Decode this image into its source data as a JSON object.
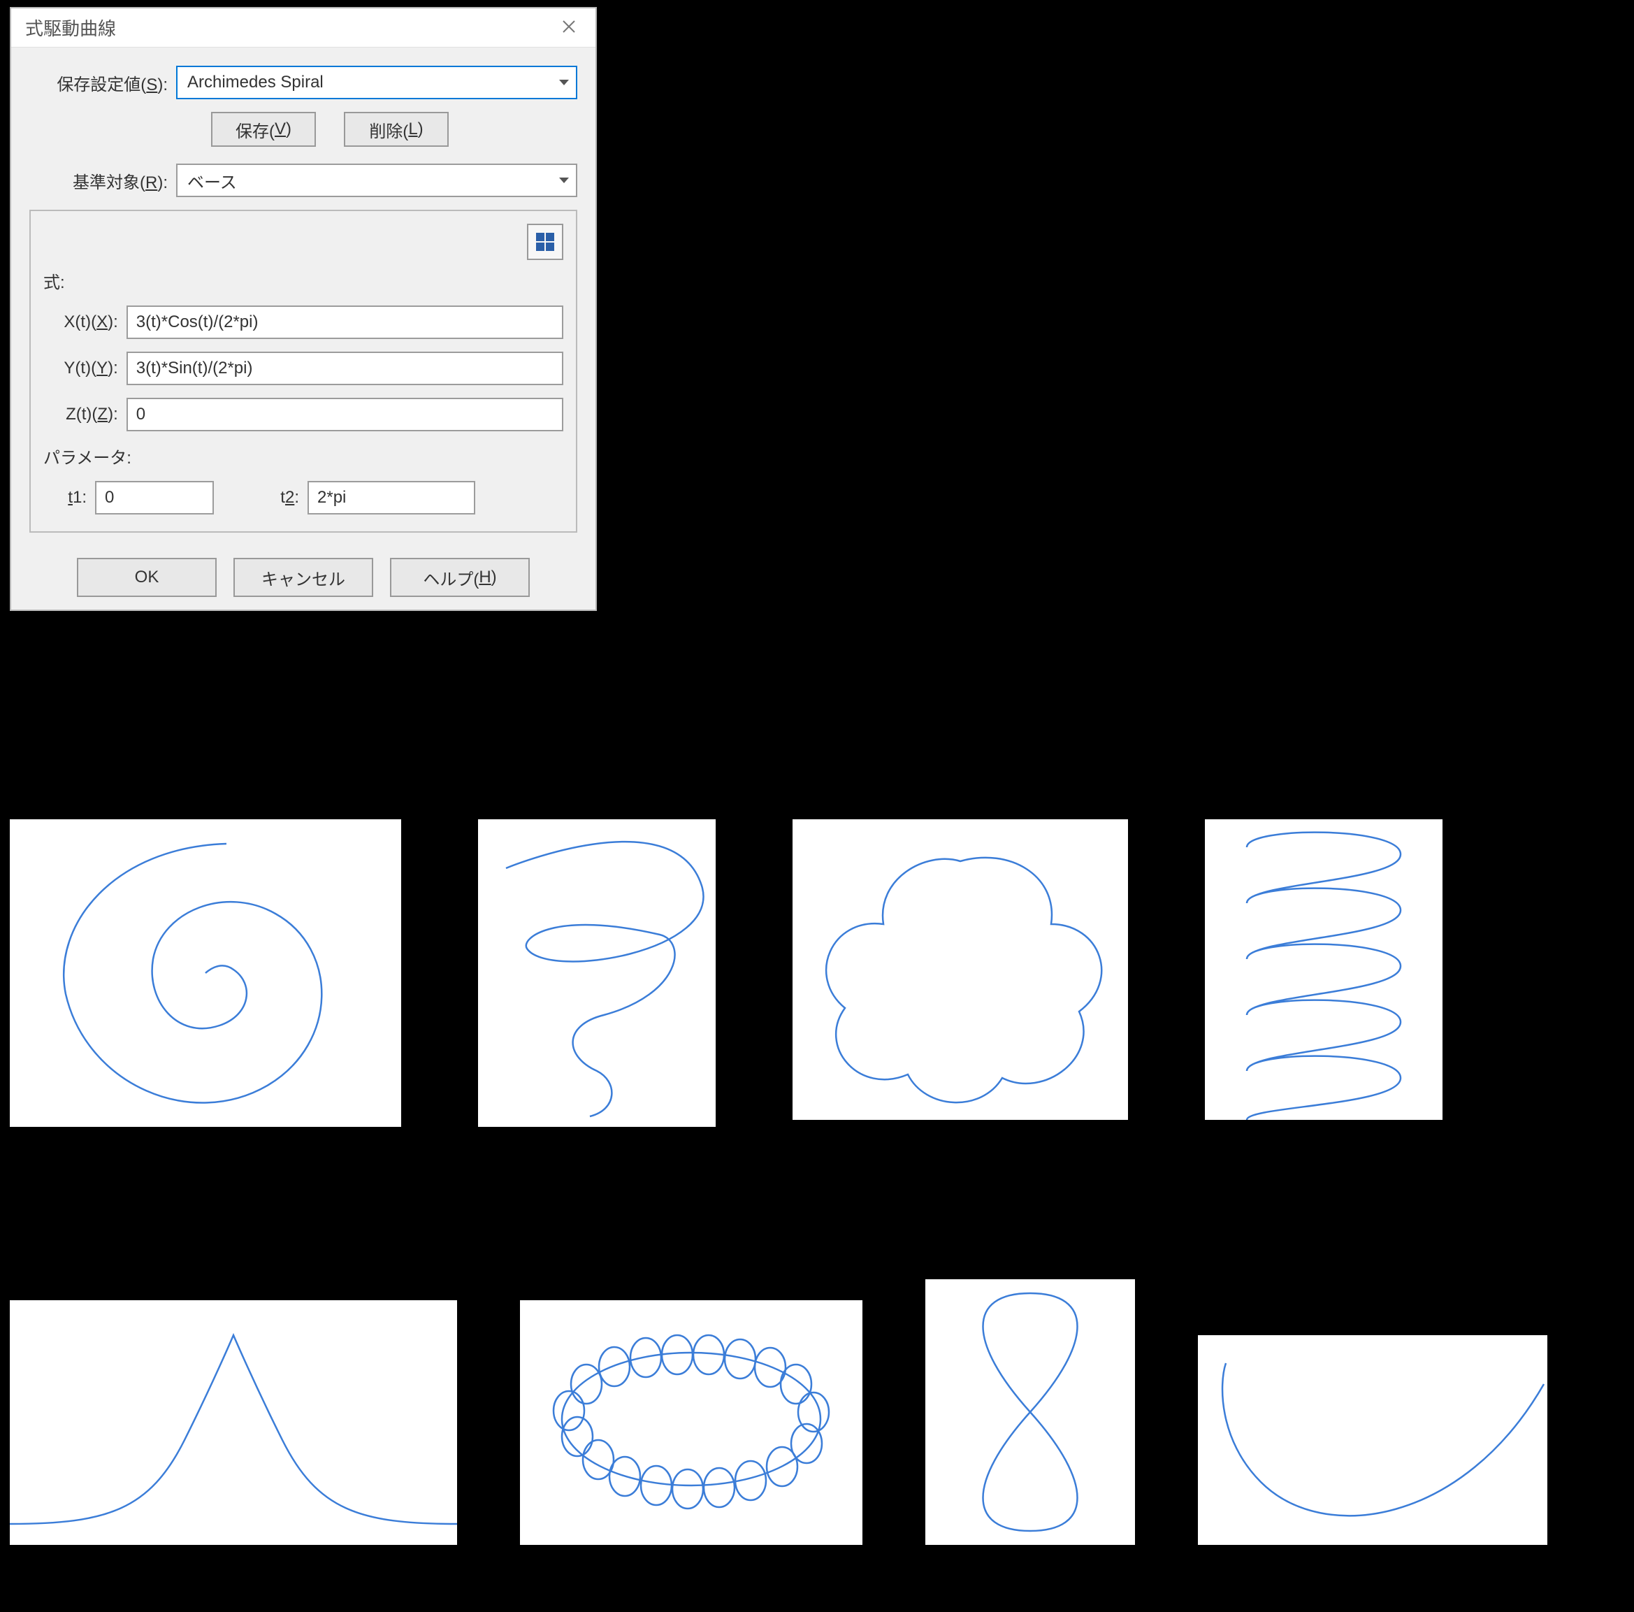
{
  "dialog": {
    "title": "式駆動曲線",
    "saved_label": "保存設定値(S):",
    "saved_value": "Archimedes Spiral",
    "save_btn": "保存(V)",
    "delete_btn": "削除(L)",
    "ref_label": "基準対象(R):",
    "ref_value": "ベース",
    "formula_section": "式:",
    "x_label": "X(t)(X):",
    "x_value": "3(t)*Cos(t)/(2*pi)",
    "y_label": "Y(t)(Y):",
    "y_value": "3(t)*Sin(t)/(2*pi)",
    "z_label": "Z(t)(Z):",
    "z_value": "0",
    "param_section": "パラメータ:",
    "t1_label": "t1:",
    "t1_value": "0",
    "t2_label": "t2:",
    "t2_value": "2*pi",
    "ok": "OK",
    "cancel": "キャンセル",
    "help": "ヘルプ(H)"
  },
  "previews": [
    {
      "name": "archimedes-spiral"
    },
    {
      "name": "conical-spiral"
    },
    {
      "name": "flower-cloud"
    },
    {
      "name": "coil-spring"
    },
    {
      "name": "gaussian-bell"
    },
    {
      "name": "toroidal-coil"
    },
    {
      "name": "figure-eight"
    },
    {
      "name": "catenary-hook"
    }
  ]
}
